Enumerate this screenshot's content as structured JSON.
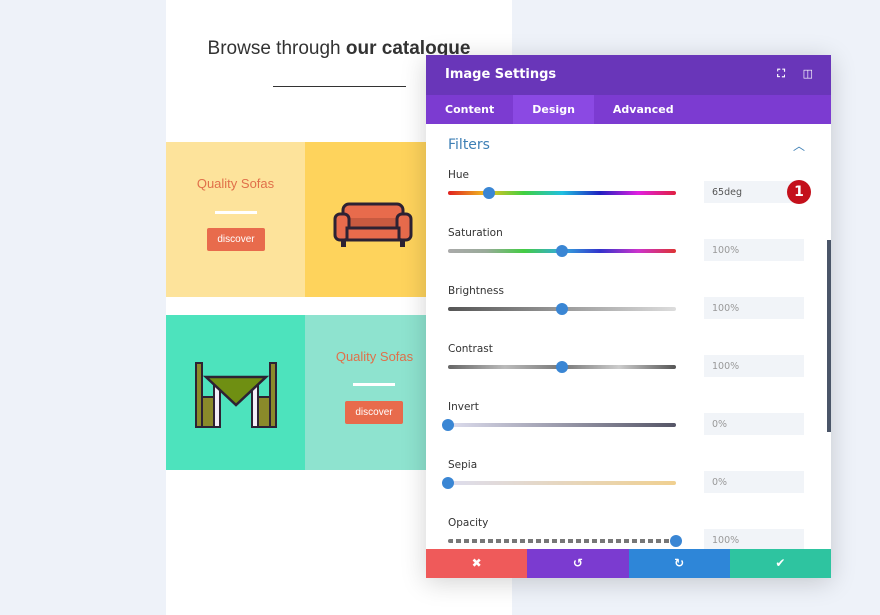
{
  "page": {
    "title_plain": "Browse through ",
    "title_bold": "our catalogue"
  },
  "cards": [
    {
      "title": "Quality Sofas",
      "button": "discover",
      "icon": "sofa-icon"
    },
    {
      "title": "Quality Sofas",
      "button": "discover",
      "icon": "dining-table-icon"
    }
  ],
  "panel": {
    "title": "Image Settings",
    "tabs": [
      {
        "label": "Content"
      },
      {
        "label": "Design",
        "active": true
      },
      {
        "label": "Advanced"
      }
    ],
    "section": "Filters",
    "filters": [
      {
        "label": "Hue",
        "value": "65deg",
        "fraction": 0.18
      },
      {
        "label": "Saturation",
        "value": "100%",
        "fraction": 0.5
      },
      {
        "label": "Brightness",
        "value": "100%",
        "fraction": 0.5
      },
      {
        "label": "Contrast",
        "value": "100%",
        "fraction": 0.5
      },
      {
        "label": "Invert",
        "value": "0%",
        "fraction": 0
      },
      {
        "label": "Sepia",
        "value": "0%",
        "fraction": 0
      },
      {
        "label": "Opacity",
        "value": "100%",
        "fraction": 1
      }
    ],
    "badge": "1",
    "footer": {
      "cancel": "✖",
      "undo": "↺",
      "redo": "↻",
      "save": "✔"
    }
  },
  "colors": {
    "purple": "#6936b9",
    "cancel": "#ef5a5a",
    "undo": "#7b3bd0",
    "redo": "#2e86d8",
    "save": "#2ec4a0"
  }
}
